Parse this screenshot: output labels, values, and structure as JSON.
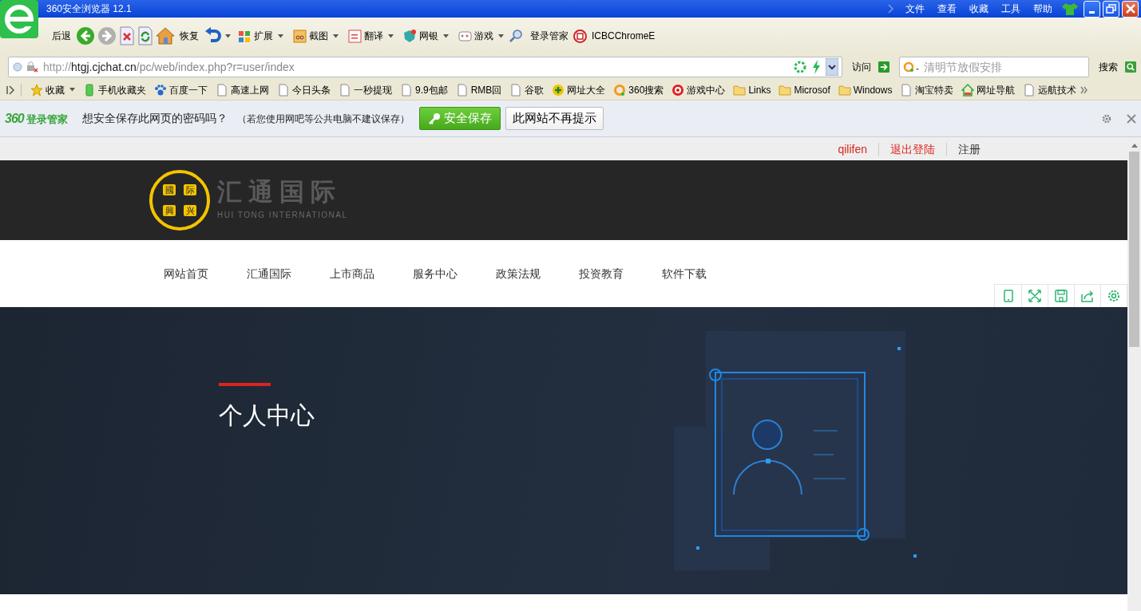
{
  "window": {
    "title": "360安全浏览器 12.1",
    "menu": [
      "文件",
      "查看",
      "收藏",
      "工具",
      "帮助"
    ]
  },
  "toolbar": {
    "back_label": "后退",
    "restore_label": "恢复",
    "menus": [
      "扩展",
      "截图",
      "翻译",
      "网银",
      "游戏"
    ],
    "login_manager": "登录管家",
    "icbc": "ICBCChromeE"
  },
  "address_bar": {
    "url_parts": [
      "http://",
      "htgj.cjchat.cn",
      "/pc/web/index.php?r=user/index"
    ],
    "go_label": "访问",
    "search_placeholder": "清明节放假安排",
    "search_label": "搜索"
  },
  "bookmarks": [
    {
      "kind": "star",
      "label": "收藏"
    },
    {
      "kind": "phone",
      "label": "手机收藏夹"
    },
    {
      "kind": "paw",
      "label": "百度一下"
    },
    {
      "kind": "page",
      "label": "高速上网"
    },
    {
      "kind": "page",
      "label": "今日头条"
    },
    {
      "kind": "page",
      "label": "一秒提现"
    },
    {
      "kind": "page",
      "label": "9.9包邮"
    },
    {
      "kind": "page",
      "label": "RMB回"
    },
    {
      "kind": "page",
      "label": "谷歌"
    },
    {
      "kind": "plus",
      "label": "网址大全"
    },
    {
      "kind": "ring",
      "label": "360搜索"
    },
    {
      "kind": "game",
      "label": "游戏中心"
    },
    {
      "kind": "folder",
      "label": "Links"
    },
    {
      "kind": "folder",
      "label": "Microsof"
    },
    {
      "kind": "folder",
      "label": "Windows"
    },
    {
      "kind": "page",
      "label": "淘宝特卖"
    },
    {
      "kind": "house",
      "label": "网址导航"
    },
    {
      "kind": "page",
      "label": "远航技术"
    }
  ],
  "password_bar": {
    "logo_number": "360",
    "logo_text": "登录管家",
    "question": "想安全保存此网页的密码吗？",
    "note": "（若您使用网吧等公共电脑不建议保存）",
    "save_button": "安全保存",
    "dismiss_button": "此网站不再提示"
  },
  "page": {
    "user_links": [
      {
        "label": "qilifen",
        "kind": "link"
      },
      {
        "label": "退出登陆",
        "kind": "link"
      },
      {
        "label": "注册",
        "kind": "plain"
      }
    ],
    "brand": {
      "logo_chars": [
        "國",
        "际",
        "興",
        "兴"
      ],
      "name": "汇通国际",
      "name_en": "HUI TONG INTERNATIONAL"
    },
    "nav": [
      "网站首页",
      "汇通国际",
      "上市商品",
      "服务中心",
      "政策法规",
      "投资教育",
      "软件下载"
    ],
    "banner_title": "个人中心"
  }
}
